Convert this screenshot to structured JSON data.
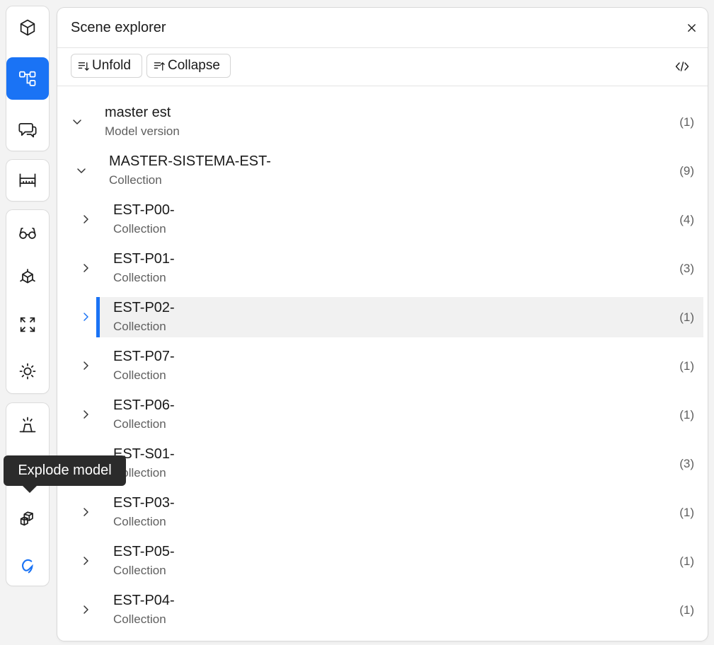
{
  "panel": {
    "title": "Scene explorer",
    "close_icon": "close-icon",
    "code_icon": "code-icon"
  },
  "toolbar": {
    "unfold_label": "Unfold",
    "collapse_label": "Collapse"
  },
  "tooltip": {
    "text": "Explode model"
  },
  "accent_color": "#1a73f5",
  "sidebar_tools": [
    {
      "icon": "cube-icon",
      "active": false
    },
    {
      "icon": "tree-structure-icon",
      "active": true
    },
    {
      "icon": "comments-icon",
      "active": false
    },
    {
      "icon": "measure-ruler-icon",
      "active": false
    },
    {
      "icon": "glasses-icon",
      "active": false
    },
    {
      "icon": "section-box-icon",
      "active": false
    },
    {
      "icon": "fit-view-icon",
      "active": false
    },
    {
      "icon": "sun-light-icon",
      "active": false
    },
    {
      "icon": "presentation-icon",
      "active": false
    },
    {
      "icon": "explode-model-icon",
      "active": false
    },
    {
      "icon": "speckle-logo-icon",
      "active": false
    }
  ],
  "tree": {
    "items": [
      {
        "name": "master est",
        "type": "Model version",
        "count": "(1)",
        "expanded": true,
        "level": 0,
        "selected": false
      },
      {
        "name": "MASTER-SISTEMA-EST-",
        "type": "Collection",
        "count": "(9)",
        "expanded": true,
        "level": 1,
        "selected": false
      },
      {
        "name": "EST-P00-",
        "type": "Collection",
        "count": "(4)",
        "expanded": false,
        "level": 2,
        "selected": false
      },
      {
        "name": "EST-P01-",
        "type": "Collection",
        "count": "(3)",
        "expanded": false,
        "level": 2,
        "selected": false
      },
      {
        "name": "EST-P02-",
        "type": "Collection",
        "count": "(1)",
        "expanded": false,
        "level": 2,
        "selected": true
      },
      {
        "name": "EST-P07-",
        "type": "Collection",
        "count": "(1)",
        "expanded": false,
        "level": 2,
        "selected": false
      },
      {
        "name": "EST-P06-",
        "type": "Collection",
        "count": "(1)",
        "expanded": false,
        "level": 2,
        "selected": false
      },
      {
        "name": "EST-S01-",
        "type": "Collection",
        "count": "(3)",
        "expanded": false,
        "level": 2,
        "selected": false
      },
      {
        "name": "EST-P03-",
        "type": "Collection",
        "count": "(1)",
        "expanded": false,
        "level": 2,
        "selected": false
      },
      {
        "name": "EST-P05-",
        "type": "Collection",
        "count": "(1)",
        "expanded": false,
        "level": 2,
        "selected": false
      },
      {
        "name": "EST-P04-",
        "type": "Collection",
        "count": "(1)",
        "expanded": false,
        "level": 2,
        "selected": false
      }
    ]
  }
}
